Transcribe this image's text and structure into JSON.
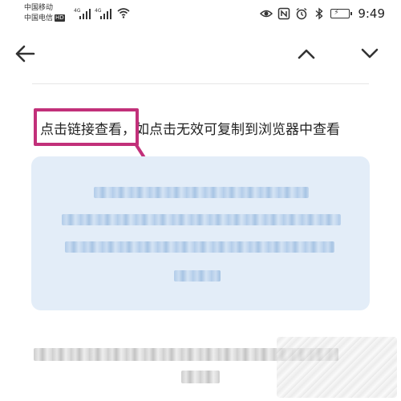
{
  "status_bar": {
    "carrier_1": "中国移动",
    "carrier_2": "中国电信",
    "hd_badge": "HD",
    "network_gen_1": "4G",
    "network_gen_2": "4G",
    "icons": [
      "eye-icon",
      "nfc-icon",
      "alarm-icon",
      "bluetooth-icon",
      "battery-charging-icon"
    ],
    "time": "9:49"
  },
  "toolbar": {
    "back_icon": "arrow-left-icon",
    "prev_icon": "chevron-up-icon",
    "next_icon": "chevron-down-icon"
  },
  "message": {
    "link_hint": "点击链接查看，",
    "rest_text": "如点击无效可复制到浏览器中查看"
  },
  "annotation": {
    "highlight_color": "#c2307a"
  },
  "link_card": {
    "background": "#e3edf8"
  }
}
